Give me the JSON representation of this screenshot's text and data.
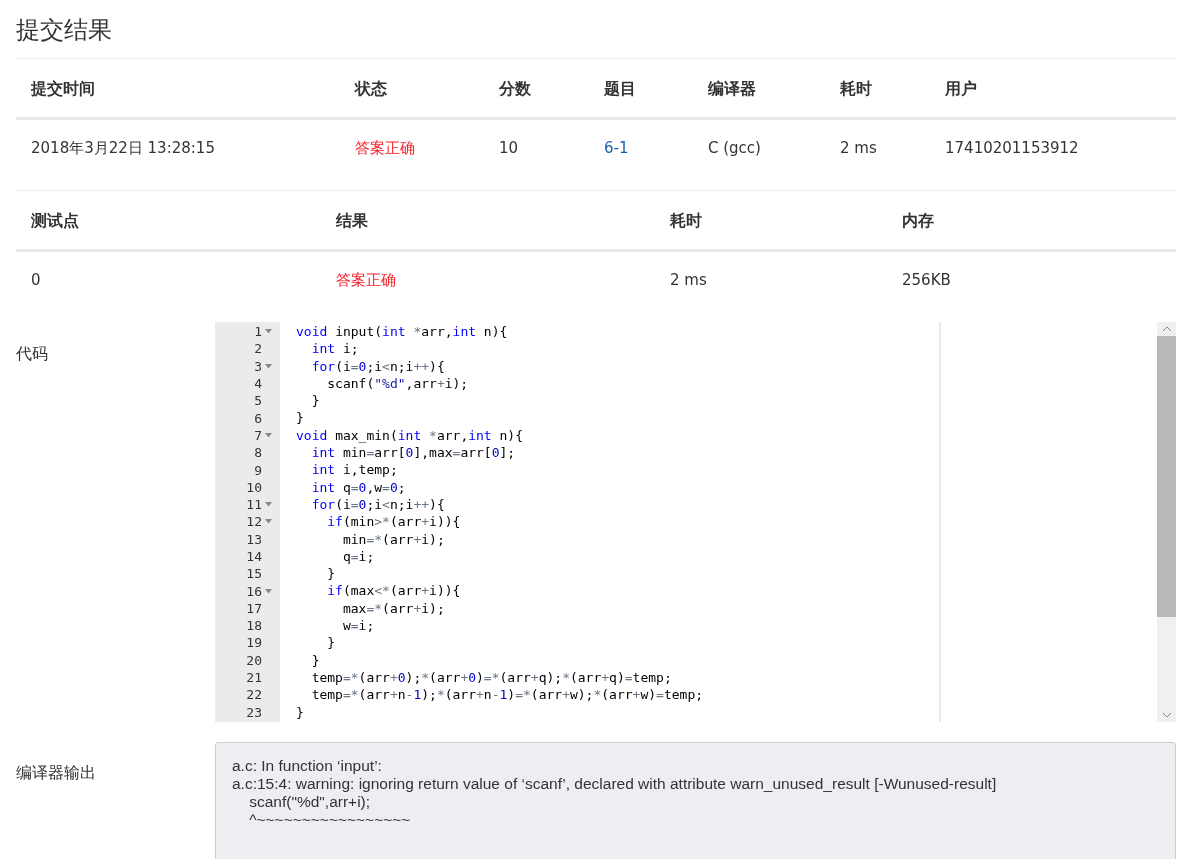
{
  "title": "提交结果",
  "submission": {
    "columns": [
      "提交时间",
      "状态",
      "分数",
      "题目",
      "编译器",
      "耗时",
      "用户"
    ],
    "row": [
      {
        "kind": "text",
        "text": "2018年3月22日 13:28:15"
      },
      {
        "kind": "accepted",
        "text": "答案正确"
      },
      {
        "kind": "text",
        "text": "10"
      },
      {
        "kind": "link",
        "text": "6-1"
      },
      {
        "kind": "text",
        "text": "C (gcc)"
      },
      {
        "kind": "text",
        "text": "2 ms"
      },
      {
        "kind": "text",
        "text": "17410201153912"
      }
    ]
  },
  "tests": {
    "columns": [
      "测试点",
      "结果",
      "耗时",
      "内存"
    ],
    "row": [
      {
        "kind": "text",
        "text": "0"
      },
      {
        "kind": "accepted",
        "text": "答案正确"
      },
      {
        "kind": "text",
        "text": "2 ms"
      },
      {
        "kind": "text",
        "text": "256KB"
      }
    ]
  },
  "code": {
    "label": "代码",
    "lines": [
      {
        "number": "1",
        "fold": true,
        "tokens": [
          {
            "kind": "keyword",
            "text": "void"
          },
          {
            "kind": "plain",
            "text": " input("
          },
          {
            "kind": "keyword",
            "text": "int "
          },
          {
            "kind": "operator",
            "text": "*"
          },
          {
            "kind": "plain",
            "text": "arr,"
          },
          {
            "kind": "keyword",
            "text": "int"
          },
          {
            "kind": "plain",
            "text": " n){"
          }
        ],
        "children": [
          {
            "number": "2",
            "fold": false,
            "tokens": [
              {
                "kind": "keyword",
                "text": "int"
              },
              {
                "kind": "plain",
                "text": " i;"
              }
            ]
          },
          {
            "number": "3",
            "fold": true,
            "tokens": [
              {
                "kind": "keyword",
                "text": "for"
              },
              {
                "kind": "plain",
                "text": "(i"
              },
              {
                "kind": "operator",
                "text": "="
              },
              {
                "kind": "number",
                "text": "0"
              },
              {
                "kind": "plain",
                "text": ";i"
              },
              {
                "kind": "operator",
                "text": "<"
              },
              {
                "kind": "plain",
                "text": "n;i"
              },
              {
                "kind": "operator",
                "text": "++"
              },
              {
                "kind": "plain",
                "text": "){"
              }
            ],
            "children": [
              {
                "number": "4",
                "fold": false,
                "tokens": [
                  {
                    "kind": "plain",
                    "text": "scanf("
                  },
                  {
                    "kind": "string",
                    "text": "\"%d\""
                  },
                  {
                    "kind": "plain",
                    "text": ",arr"
                  },
                  {
                    "kind": "operator",
                    "text": "+"
                  },
                  {
                    "kind": "plain",
                    "text": "i);"
                  }
                ]
              }
            ]
          },
          {
            "number": "5",
            "fold": false,
            "tokens": [
              {
                "kind": "plain",
                "text": "}"
              }
            ]
          }
        ]
      },
      {
        "number": "6",
        "fold": false,
        "tokens": [
          {
            "kind": "plain",
            "text": "}"
          }
        ]
      },
      {
        "number": "7",
        "fold": true,
        "tokens": [
          {
            "kind": "keyword",
            "text": "void"
          },
          {
            "kind": "plain",
            "text": " max_min("
          },
          {
            "kind": "keyword",
            "text": "int "
          },
          {
            "kind": "operator",
            "text": "*"
          },
          {
            "kind": "plain",
            "text": "arr,"
          },
          {
            "kind": "keyword",
            "text": "int"
          },
          {
            "kind": "plain",
            "text": " n){"
          }
        ],
        "children": [
          {
            "number": "8",
            "fold": false,
            "tokens": [
              {
                "kind": "keyword",
                "text": "int"
              },
              {
                "kind": "plain",
                "text": " min"
              },
              {
                "kind": "operator",
                "text": "="
              },
              {
                "kind": "plain",
                "text": "arr["
              },
              {
                "kind": "number",
                "text": "0"
              },
              {
                "kind": "plain",
                "text": "],max"
              },
              {
                "kind": "operator",
                "text": "="
              },
              {
                "kind": "plain",
                "text": "arr["
              },
              {
                "kind": "number",
                "text": "0"
              },
              {
                "kind": "plain",
                "text": "];"
              }
            ]
          },
          {
            "number": "9",
            "fold": false,
            "tokens": [
              {
                "kind": "keyword",
                "text": "int"
              },
              {
                "kind": "plain",
                "text": " i,temp;"
              }
            ]
          },
          {
            "number": "10",
            "fold": false,
            "tokens": [
              {
                "kind": "keyword",
                "text": "int"
              },
              {
                "kind": "plain",
                "text": " q"
              },
              {
                "kind": "operator",
                "text": "="
              },
              {
                "kind": "number",
                "text": "0"
              },
              {
                "kind": "plain",
                "text": ",w"
              },
              {
                "kind": "operator",
                "text": "="
              },
              {
                "kind": "number",
                "text": "0"
              },
              {
                "kind": "plain",
                "text": ";"
              }
            ]
          },
          {
            "number": "11",
            "fold": true,
            "tokens": [
              {
                "kind": "keyword",
                "text": "for"
              },
              {
                "kind": "plain",
                "text": "(i"
              },
              {
                "kind": "operator",
                "text": "="
              },
              {
                "kind": "number",
                "text": "0"
              },
              {
                "kind": "plain",
                "text": ";i"
              },
              {
                "kind": "operator",
                "text": "<"
              },
              {
                "kind": "plain",
                "text": "n;i"
              },
              {
                "kind": "operator",
                "text": "++"
              },
              {
                "kind": "plain",
                "text": "){"
              }
            ],
            "children": [
              {
                "number": "12",
                "fold": true,
                "tokens": [
                  {
                    "kind": "keyword",
                    "text": "if"
                  },
                  {
                    "kind": "plain",
                    "text": "(min"
                  },
                  {
                    "kind": "operator",
                    "text": ">*"
                  },
                  {
                    "kind": "plain",
                    "text": "(arr"
                  },
                  {
                    "kind": "operator",
                    "text": "+"
                  },
                  {
                    "kind": "plain",
                    "text": "i)){"
                  }
                ],
                "children": [
                  {
                    "number": "13",
                    "fold": false,
                    "tokens": [
                      {
                        "kind": "plain",
                        "text": "min"
                      },
                      {
                        "kind": "operator",
                        "text": "=*"
                      },
                      {
                        "kind": "plain",
                        "text": "(arr"
                      },
                      {
                        "kind": "operator",
                        "text": "+"
                      },
                      {
                        "kind": "plain",
                        "text": "i);"
                      }
                    ]
                  },
                  {
                    "number": "14",
                    "fold": false,
                    "tokens": [
                      {
                        "kind": "plain",
                        "text": "q"
                      },
                      {
                        "kind": "operator",
                        "text": "="
                      },
                      {
                        "kind": "plain",
                        "text": "i;"
                      }
                    ]
                  }
                ]
              },
              {
                "number": "15",
                "fold": false,
                "tokens": [
                  {
                    "kind": "plain",
                    "text": "}"
                  }
                ]
              },
              {
                "number": "16",
                "fold": true,
                "tokens": [
                  {
                    "kind": "keyword",
                    "text": "if"
                  },
                  {
                    "kind": "plain",
                    "text": "(max"
                  },
                  {
                    "kind": "operator",
                    "text": "<*"
                  },
                  {
                    "kind": "plain",
                    "text": "(arr"
                  },
                  {
                    "kind": "operator",
                    "text": "+"
                  },
                  {
                    "kind": "plain",
                    "text": "i)){"
                  }
                ],
                "children": [
                  {
                    "number": "17",
                    "fold": false,
                    "tokens": [
                      {
                        "kind": "plain",
                        "text": "max"
                      },
                      {
                        "kind": "operator",
                        "text": "=*"
                      },
                      {
                        "kind": "plain",
                        "text": "(arr"
                      },
                      {
                        "kind": "operator",
                        "text": "+"
                      },
                      {
                        "kind": "plain",
                        "text": "i);"
                      }
                    ]
                  },
                  {
                    "number": "18",
                    "fold": false,
                    "tokens": [
                      {
                        "kind": "plain",
                        "text": "w"
                      },
                      {
                        "kind": "operator",
                        "text": "="
                      },
                      {
                        "kind": "plain",
                        "text": "i;"
                      }
                    ]
                  }
                ]
              },
              {
                "number": "19",
                "fold": false,
                "tokens": [
                  {
                    "kind": "plain",
                    "text": "}"
                  }
                ]
              }
            ]
          },
          {
            "number": "20",
            "fold": false,
            "tokens": [
              {
                "kind": "plain",
                "text": "}"
              }
            ]
          },
          {
            "number": "21",
            "fold": false,
            "tokens": [
              {
                "kind": "plain",
                "text": "temp"
              },
              {
                "kind": "operator",
                "text": "=*"
              },
              {
                "kind": "plain",
                "text": "(arr"
              },
              {
                "kind": "operator",
                "text": "+"
              },
              {
                "kind": "number",
                "text": "0"
              },
              {
                "kind": "plain",
                "text": ");"
              },
              {
                "kind": "operator",
                "text": "*"
              },
              {
                "kind": "plain",
                "text": "(arr"
              },
              {
                "kind": "operator",
                "text": "+"
              },
              {
                "kind": "number",
                "text": "0"
              },
              {
                "kind": "plain",
                "text": ")"
              },
              {
                "kind": "operator",
                "text": "=*"
              },
              {
                "kind": "plain",
                "text": "(arr"
              },
              {
                "kind": "operator",
                "text": "+"
              },
              {
                "kind": "plain",
                "text": "q);"
              },
              {
                "kind": "operator",
                "text": "*"
              },
              {
                "kind": "plain",
                "text": "(arr"
              },
              {
                "kind": "operator",
                "text": "+"
              },
              {
                "kind": "plain",
                "text": "q)"
              },
              {
                "kind": "operator",
                "text": "="
              },
              {
                "kind": "plain",
                "text": "temp;"
              }
            ]
          },
          {
            "number": "22",
            "fold": false,
            "tokens": [
              {
                "kind": "plain",
                "text": "temp"
              },
              {
                "kind": "operator",
                "text": "=*"
              },
              {
                "kind": "plain",
                "text": "(arr"
              },
              {
                "kind": "operator",
                "text": "+"
              },
              {
                "kind": "plain",
                "text": "n"
              },
              {
                "kind": "operator",
                "text": "-"
              },
              {
                "kind": "number",
                "text": "1"
              },
              {
                "kind": "plain",
                "text": ");"
              },
              {
                "kind": "operator",
                "text": "*"
              },
              {
                "kind": "plain",
                "text": "(arr"
              },
              {
                "kind": "operator",
                "text": "+"
              },
              {
                "kind": "plain",
                "text": "n"
              },
              {
                "kind": "operator",
                "text": "-"
              },
              {
                "kind": "number",
                "text": "1"
              },
              {
                "kind": "plain",
                "text": ")"
              },
              {
                "kind": "operator",
                "text": "=*"
              },
              {
                "kind": "plain",
                "text": "(arr"
              },
              {
                "kind": "operator",
                "text": "+"
              },
              {
                "kind": "plain",
                "text": "w);"
              },
              {
                "kind": "operator",
                "text": "*"
              },
              {
                "kind": "plain",
                "text": "(arr"
              },
              {
                "kind": "operator",
                "text": "+"
              },
              {
                "kind": "plain",
                "text": "w)"
              },
              {
                "kind": "operator",
                "text": "="
              },
              {
                "kind": "plain",
                "text": "temp;"
              }
            ]
          }
        ]
      },
      {
        "number": "23",
        "fold": false,
        "tokens": [
          {
            "kind": "plain",
            "text": "}"
          }
        ]
      }
    ]
  },
  "compiler_output": {
    "label": "编译器输出",
    "lines": [
      "a.c: In function ‘input’:",
      "a.c:15:4: warning: ignoring return value of ‘scanf’, declared with attribute warn_unused_result [-Wunused-result]",
      "    scanf(\"%d\",arr+i);",
      "    ^~~~~~~~~~~~~~~~~~"
    ]
  }
}
